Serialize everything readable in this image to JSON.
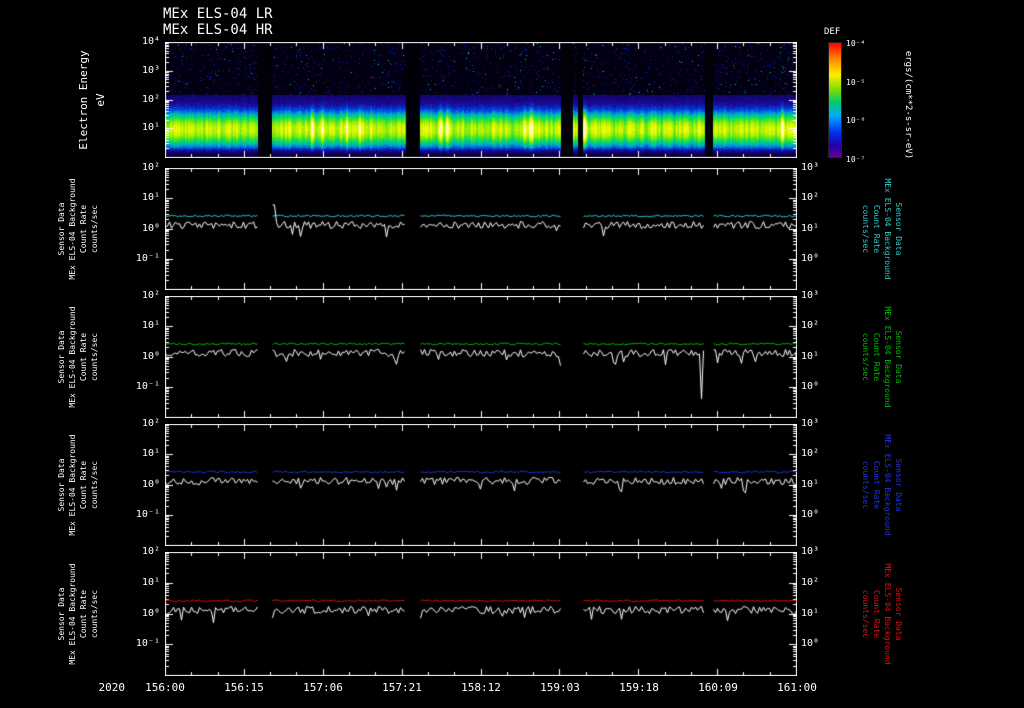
{
  "header": {
    "title_line1": "MEx ELS-04 LR",
    "title_line2": "MEx ELS-04 HR"
  },
  "x_axis": {
    "year": "2020",
    "tick_labels": [
      "156:00",
      "156:15",
      "157:06",
      "157:21",
      "158:12",
      "159:03",
      "159:18",
      "160:09",
      "161:00"
    ]
  },
  "spectrogram_panel": {
    "ylabel_line1": "Electron Energy",
    "ylabel_line2": "eV",
    "ytick_labels": [
      "10⁴",
      "10³",
      "10²",
      "10¹"
    ],
    "colorbar": {
      "title": "DEF",
      "tick_labels": [
        "10⁻⁴",
        "10⁻⁵",
        "10⁻⁶",
        "10⁻⁷"
      ],
      "units": "ergs/(cm**2-s-sr-eV)"
    }
  },
  "line_panel_labels": {
    "left_lines": [
      "Sensor Data",
      "MEx ELS-04 Background",
      "Count Rate",
      "counts/sec"
    ],
    "left_tick_labels": [
      "10²",
      "10¹",
      "10⁰",
      "10⁻¹"
    ],
    "right_tick_labels": [
      "10³",
      "10²",
      "10¹",
      "10⁰"
    ]
  },
  "line_panels": [
    {
      "name": "background-panel-1",
      "color": "#33cccc",
      "right_lines": [
        "Sensor Data",
        "MEx ELS-04 Background",
        "Count Rate",
        "counts/sec"
      ]
    },
    {
      "name": "background-panel-2",
      "color": "#00bb00",
      "right_lines": [
        "Sensor Data",
        "MEx ELS-04 Background",
        "Count Rate",
        "counts/sec"
      ]
    },
    {
      "name": "background-panel-3",
      "color": "#2233dd",
      "right_lines": [
        "Sensor Data",
        "MEx ELS-04 Background",
        "Count Rate",
        "counts/sec"
      ]
    },
    {
      "name": "background-panel-4",
      "color": "#dd1111",
      "right_lines": [
        "Sensor Data",
        "MEx ELS-04 Background",
        "Count Rate",
        "counts/sec"
      ]
    }
  ],
  "chart_data": [
    {
      "type": "heatmap",
      "title": "MEx ELS-04 HR",
      "ylabel": "Electron Energy (eV)",
      "yscale": "log",
      "ylim": [
        1,
        10000
      ],
      "ytick_labels": [
        "10^4",
        "10^3",
        "10^2",
        "10^1"
      ],
      "x_tick_labels": [
        "156:00",
        "156:15",
        "157:06",
        "157:21",
        "158:12",
        "159:03",
        "159:18",
        "160:09",
        "161:00"
      ],
      "x_units": "2020 day-of-year:hour",
      "value_label": "DEF",
      "value_units": "ergs/(cm**2-s-sr-eV)",
      "value_tick_labels": [
        "10^-4",
        "10^-5",
        "10^-6",
        "10^-7"
      ],
      "peak_band_energy_ev": 10,
      "data_segments_frac": [
        [
          0,
          0.147
        ],
        [
          0.168,
          0.38
        ],
        [
          0.402,
          0.625
        ],
        [
          0.645,
          0.653
        ],
        [
          0.66,
          0.854
        ],
        [
          0.867,
          1.0
        ]
      ]
    },
    {
      "type": "line",
      "name": "els_background_panel_1",
      "yscale": "log",
      "ylim_left": [
        0.01,
        100
      ],
      "ylim_right": [
        0.1,
        1000
      ],
      "series": [
        {
          "name": "background",
          "color": "#33cccc",
          "approx_level": 2.6
        },
        {
          "name": "count rate",
          "color": "#ffffff",
          "approx_level": 1.3
        }
      ],
      "spike": {
        "series": "count rate",
        "frac": 0.172,
        "value": 6
      }
    },
    {
      "type": "line",
      "name": "els_background_panel_2",
      "yscale": "log",
      "ylim_left": [
        0.01,
        100
      ],
      "ylim_right": [
        0.1,
        1000
      ],
      "series": [
        {
          "name": "background",
          "color": "#00bb00",
          "approx_level": 2.6
        },
        {
          "name": "count rate",
          "color": "#ffffff",
          "approx_level": 1.3
        }
      ],
      "spike": {
        "series": "count rate",
        "frac": 0.848,
        "value": 0.04
      }
    },
    {
      "type": "line",
      "name": "els_background_panel_3",
      "yscale": "log",
      "ylim_left": [
        0.01,
        100
      ],
      "ylim_right": [
        0.1,
        1000
      ],
      "series": [
        {
          "name": "background",
          "color": "#2233dd",
          "approx_level": 2.6
        },
        {
          "name": "count rate",
          "color": "#ffffff",
          "approx_level": 1.3
        }
      ],
      "spike": null
    },
    {
      "type": "line",
      "name": "els_background_panel_4",
      "yscale": "log",
      "ylim_left": [
        0.01,
        100
      ],
      "ylim_right": [
        0.1,
        1000
      ],
      "series": [
        {
          "name": "background",
          "color": "#dd1111",
          "approx_level": 2.6
        },
        {
          "name": "count rate",
          "color": "#ffffff",
          "approx_level": 1.3
        }
      ],
      "spike": null
    }
  ]
}
